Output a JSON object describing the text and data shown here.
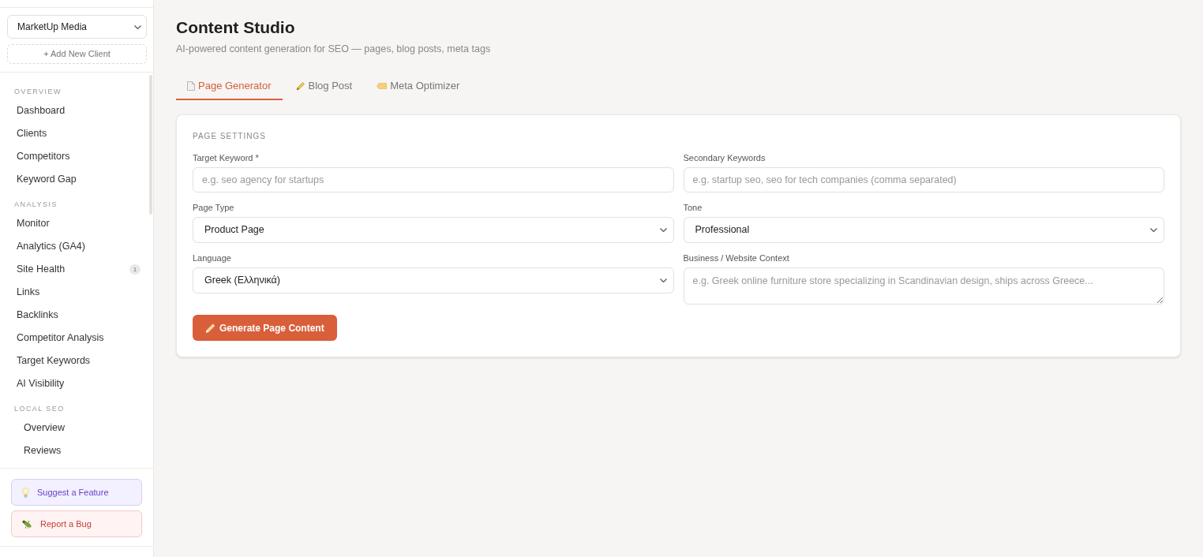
{
  "sidebar": {
    "client_select": {
      "value": "MarketUp Media"
    },
    "add_client_label": "+ Add New Client",
    "sections": [
      {
        "title": "OVERVIEW",
        "kind": "list",
        "items": [
          {
            "label": "Dashboard",
            "selected": false
          },
          {
            "label": "Clients",
            "selected": false
          },
          {
            "label": "Competitors",
            "selected": false
          },
          {
            "label": "Keyword Gap",
            "selected": false
          }
        ]
      },
      {
        "title": "ANALYSIS",
        "kind": "list",
        "items": [
          {
            "label": "Monitor",
            "selected": false
          },
          {
            "label": "Analytics (GA4)",
            "selected": false
          },
          {
            "label": "Site Health",
            "selected": false,
            "badge": "1"
          },
          {
            "label": "Links",
            "selected": false
          },
          {
            "label": "Backlinks",
            "selected": false
          },
          {
            "label": "Competitor Analysis",
            "selected": false
          },
          {
            "label": "Target Keywords",
            "selected": false
          },
          {
            "label": "AI Visibility",
            "selected": false
          }
        ]
      },
      {
        "title": "LOCAL SEO",
        "kind": "group",
        "items": [
          {
            "label": "Overview",
            "selected": false
          },
          {
            "label": "Reviews",
            "selected": false
          }
        ]
      }
    ],
    "footer_buttons": [
      {
        "kind": "feature",
        "label": "Suggest a Feature"
      },
      {
        "kind": "bug",
        "label": "Report a Bug"
      }
    ]
  },
  "header": {
    "title": "Content Studio",
    "subtitle": "AI-powered content generation for SEO — pages, blog posts, meta tags"
  },
  "tabs": [
    {
      "label": "Page Generator",
      "selected": true
    },
    {
      "label": "Blog Post",
      "selected": false
    },
    {
      "label": "Meta Optimizer",
      "selected": false
    }
  ],
  "form": {
    "title": "PAGE SETTINGS",
    "fields": [
      {
        "kind": "input",
        "label": "Target Keyword *",
        "placeholder": "e.g. seo agency for startups"
      },
      {
        "kind": "input",
        "label": "Secondary Keywords",
        "placeholder": "e.g. startup seo, seo for tech companies (comma separated)"
      },
      {
        "kind": "select",
        "label": "Page Type",
        "value": "Product Page"
      },
      {
        "kind": "select",
        "label": "Tone",
        "value": "Professional"
      },
      {
        "kind": "select",
        "label": "Language",
        "value": "Greek (Ελληνικά)"
      },
      {
        "kind": "textarea",
        "label": "Business / Website Context",
        "placeholder": "e.g. Greek online furniture store specializing in Scandinavian design, ships across Greece..."
      }
    ],
    "submit_label": "Generate Page Content"
  }
}
